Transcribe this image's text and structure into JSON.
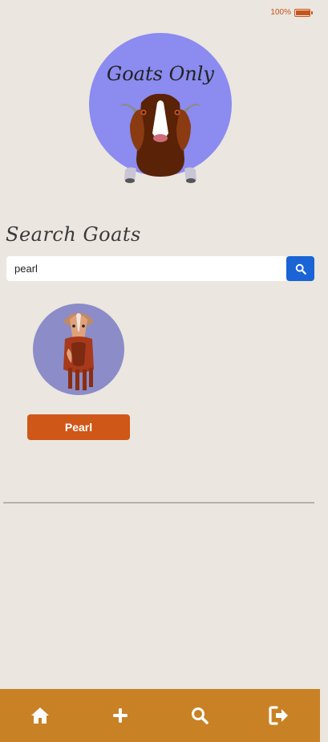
{
  "status": {
    "battery_text": "100%",
    "battery_level": 1.0,
    "accent_color": "#c8541c"
  },
  "logo": {
    "text": "Goats Only",
    "circle_color": "#8b8bf0"
  },
  "search": {
    "title": "Search Goats",
    "value": "pearl",
    "icon": "search-icon",
    "button_color": "#1a64d6"
  },
  "results": [
    {
      "name": "Pearl",
      "button_color": "#cf5717",
      "avatar_bg": "#8b8cc8"
    }
  ],
  "nav": {
    "background": "#c88124",
    "items": [
      {
        "icon": "home-icon"
      },
      {
        "icon": "plus-icon"
      },
      {
        "icon": "search-icon"
      },
      {
        "icon": "sign-out-icon"
      }
    ]
  }
}
